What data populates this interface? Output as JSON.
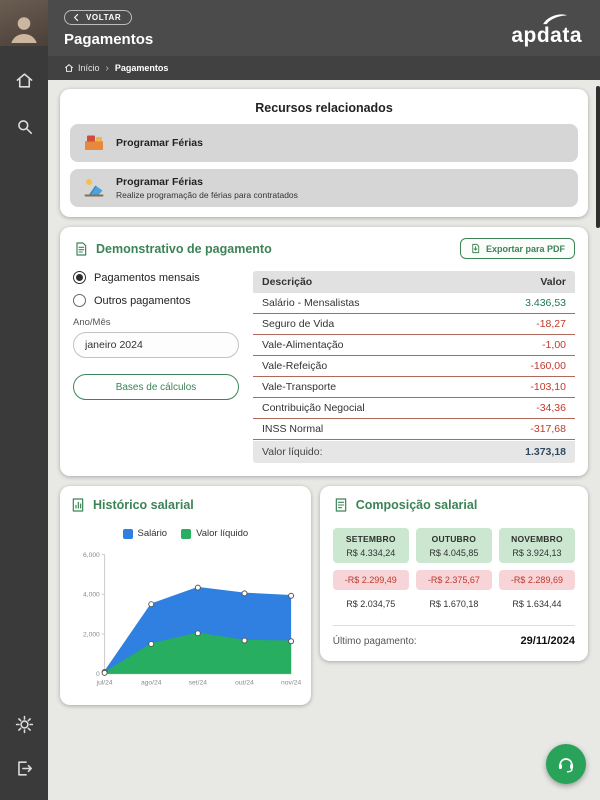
{
  "header": {
    "back_label": "VOLTAR",
    "title": "Pagamentos",
    "breadcrumb": {
      "home": "Início",
      "separator": "›",
      "current": "Pagamentos"
    },
    "logo_text": "apdata"
  },
  "related_resources": {
    "title": "Recursos relacionados",
    "items": [
      {
        "label": "Programar Férias",
        "description": ""
      },
      {
        "label": "Programar Férias",
        "description": "Realize programação de férias para contratados"
      }
    ]
  },
  "payment_statement": {
    "title": "Demonstrativo de pagamento",
    "export_button": "Exportar para PDF",
    "options": [
      {
        "label": "Pagamentos mensais",
        "selected": true
      },
      {
        "label": "Outros pagamentos",
        "selected": false
      }
    ],
    "period_label": "Ano/Mês",
    "period_value": "janeiro 2024",
    "bases_button": "Bases de cálculos",
    "table": {
      "col_description": "Descrição",
      "col_value": "Valor",
      "rows": [
        {
          "description": "Salário - Mensalistas",
          "value": "3.436,53"
        },
        {
          "description": "Seguro de Vida",
          "value": "-18,27"
        },
        {
          "description": "Vale-Alimentação",
          "value": "-1,00"
        },
        {
          "description": "Vale-Refeição",
          "value": "-160,00"
        },
        {
          "description": "Vale-Transporte",
          "value": "-103,10"
        },
        {
          "description": "Contribuição Negocial",
          "value": "-34,36"
        },
        {
          "description": "INSS Normal",
          "value": "-317,68"
        }
      ],
      "footer_label": "Valor líquido:",
      "footer_value": "1.373,18"
    }
  },
  "salary_history": {
    "title": "Histórico salarial"
  },
  "chart_data": {
    "type": "area",
    "title": "Histórico salarial",
    "x": [
      "jul/24",
      "ago/24",
      "set/24",
      "out/24",
      "nov/24"
    ],
    "series": [
      {
        "name": "Salário",
        "color": "#2f80e0",
        "values": [
          90,
          3500,
          4334,
          4046,
          3924
        ]
      },
      {
        "name": "Valor líquido",
        "color": "#27ae60",
        "values": [
          45,
          1500,
          2035,
          1670,
          1634
        ]
      }
    ],
    "ylim": [
      0,
      6000
    ],
    "yticks": [
      0,
      2000,
      4000,
      6000
    ],
    "ytick_labels": [
      "0",
      "2,000",
      "4,000",
      "6,000"
    ],
    "legend_position": "top",
    "grid": false
  },
  "salary_composition": {
    "title": "Composição salarial",
    "months": [
      {
        "name": "SETEMBRO",
        "gross": "R$ 4.334,24",
        "deduction": "-R$ 2.299,49",
        "net": "R$ 2.034,75"
      },
      {
        "name": "OUTUBRO",
        "gross": "R$ 4.045,85",
        "deduction": "-R$ 2.375,67",
        "net": "R$ 1.670,18"
      },
      {
        "name": "NOVEMBRO",
        "gross": "R$ 3.924,13",
        "deduction": "-R$ 2.289,69",
        "net": "R$ 1.634,44"
      }
    ],
    "last_payment_label": "Último pagamento:",
    "last_payment_date": "29/11/2024"
  },
  "colors": {
    "accent_green": "#3c8456",
    "positive": "#1e7a4f",
    "negative": "#c0392b",
    "fab_green": "#29a35a",
    "row_divider": "#b0685c",
    "net_total": "#2d4a63"
  }
}
